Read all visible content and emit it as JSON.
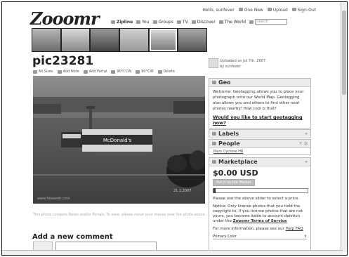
{
  "app": {
    "logo": "Zooomr"
  },
  "userbar": {
    "greeting": "Hello, sunfever",
    "new_mail": "One New",
    "upload": "Upload",
    "signout": "Sign-Out"
  },
  "nav": {
    "items": [
      "Zipline",
      "You",
      "Groups",
      "TV",
      "Discover",
      "The World"
    ],
    "search_placeholder": "Search"
  },
  "photo": {
    "title": "pic23281",
    "actions": [
      "All Sizes",
      "Add Note",
      "Add Portal",
      "90°CCW",
      "90°CW",
      "Delete"
    ],
    "caption": "This photo contains Notes and/or Portals. To view, please move your mouse over the photo above.",
    "sign_text": "McDonald's",
    "watermark": "www.fakeweb.com",
    "timestamp": "21.1.2007"
  },
  "comments": {
    "heading": "Add a new comment"
  },
  "uploaded": {
    "line1": "Uploaded on Jul 7th, 2007",
    "line2": "by sunfever"
  },
  "geo": {
    "heading": "Geo",
    "text": "Welcome: Geotagging allows you to place your photograph onto our World Map. Geotagging also allows you and others to find other neat photos nearby! How cool is that?",
    "link": "Would you like to start geotagging now?"
  },
  "labels": {
    "heading": "Labels"
  },
  "people": {
    "heading": "People",
    "tag": "Piers Cyclone HR"
  },
  "marketplace": {
    "heading": "Marketplace",
    "price": "$0.00 USD",
    "button": "Put it on the Market",
    "slider_hint": "Please use the above slider to select a price.",
    "notice_prefix": "Notice: Only license photos that you hold the copyright to; if you license photos that are not yours, you become liable to account deletion under the",
    "notice_link": "Zooomr Terms of Service",
    "more_prefix": "For more information, please see our",
    "more_link": "Help FAQ",
    "primary_label": "Primary Color",
    "price_level": 0.0
  }
}
